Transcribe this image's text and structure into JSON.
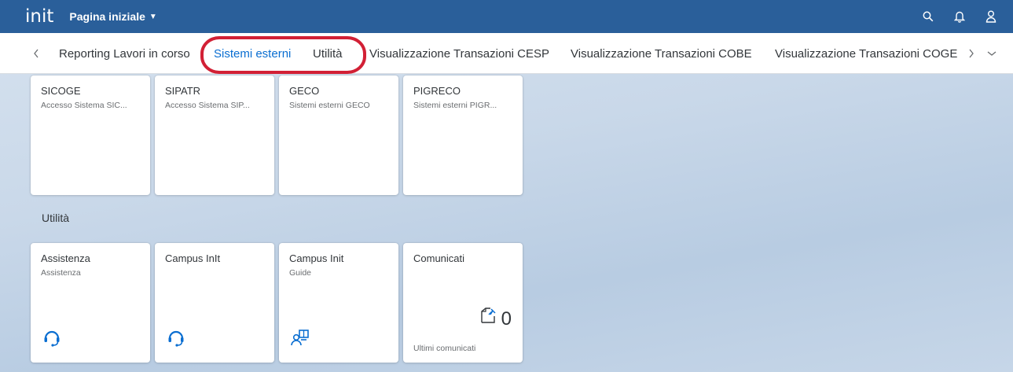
{
  "shell": {
    "logo": "init",
    "title": "Pagina iniziale",
    "icons": [
      "search-icon",
      "bell-icon",
      "user-icon"
    ]
  },
  "tabs": [
    {
      "label": "Reporting Lavori in corso",
      "active": false
    },
    {
      "label": "Sistemi esterni",
      "active": true
    },
    {
      "label": "Utilità",
      "active": false
    },
    {
      "label": "Visualizzazione Transazioni CESP",
      "active": false
    },
    {
      "label": "Visualizzazione Transazioni COBE",
      "active": false
    },
    {
      "label": "Visualizzazione Transazioni COGE",
      "active": false
    }
  ],
  "groups": {
    "sistemi_esterni": {
      "tiles": [
        {
          "title": "SICOGE",
          "subtitle": "Accesso Sistema SIC..."
        },
        {
          "title": "SIPATR",
          "subtitle": "Accesso Sistema SIP..."
        },
        {
          "title": "GECO",
          "subtitle": "Sistemi esterni GECO"
        },
        {
          "title": "PIGRECO",
          "subtitle": "Sistemi esterni PIGR..."
        }
      ]
    },
    "utilita": {
      "title": "Utilità",
      "tiles": [
        {
          "title": "Assistenza",
          "subtitle": "Assistenza",
          "icon": "headset-icon"
        },
        {
          "title": "Campus InIt",
          "subtitle": "",
          "icon": "headset-icon"
        },
        {
          "title": "Campus Init",
          "subtitle": "Guide",
          "icon": "guide-icon"
        },
        {
          "title": "Comunicati",
          "subtitle": "",
          "icon": "pinned-message-icon",
          "kpi": "0",
          "footer": "Ultimi comunicati"
        }
      ]
    }
  },
  "colors": {
    "shellbar": "#2a5f9a",
    "active_tab": "#0a6ed1",
    "highlight": "#d22035",
    "icon": "#0a6ed1"
  }
}
